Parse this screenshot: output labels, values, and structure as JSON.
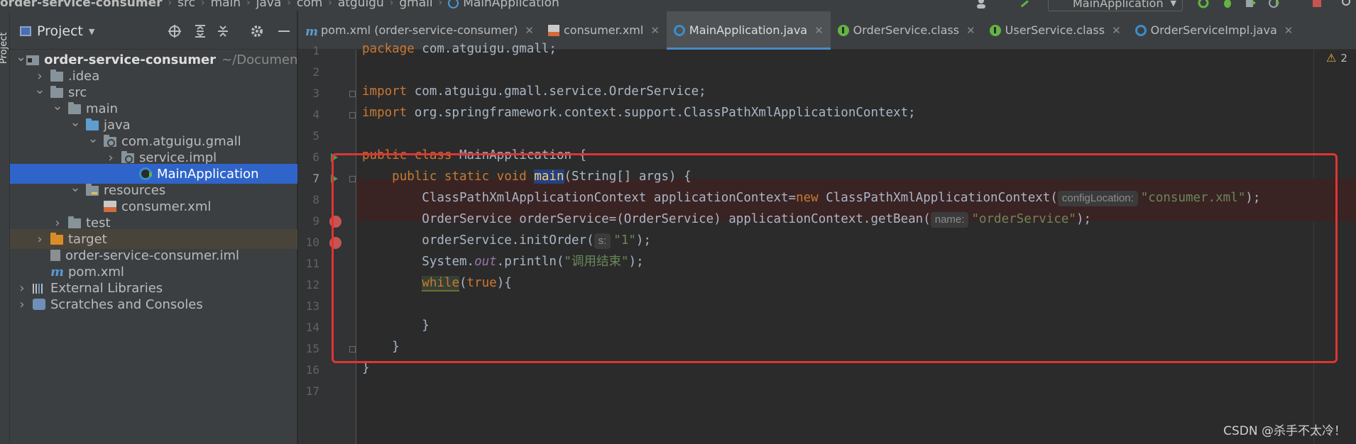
{
  "breadcrumb": {
    "items": [
      "order-service-consumer",
      "src",
      "main",
      "java",
      "com",
      "atguigu",
      "gmall",
      "MainApplication"
    ]
  },
  "toolbar": {
    "run_config": "MainApplication"
  },
  "side_strip": {
    "label": "Project"
  },
  "project_panel": {
    "title": "Project",
    "tree": [
      {
        "label": "order-service-consumer",
        "hint": "~/Documen",
        "depth": 0,
        "arrow": "open",
        "icon": "module"
      },
      {
        "label": ".idea",
        "depth": 1,
        "arrow": "closed",
        "icon": "folder"
      },
      {
        "label": "src",
        "depth": 1,
        "arrow": "open",
        "icon": "folder"
      },
      {
        "label": "main",
        "depth": 2,
        "arrow": "open",
        "icon": "folder"
      },
      {
        "label": "java",
        "depth": 3,
        "arrow": "open",
        "icon": "folder-blue"
      },
      {
        "label": "com.atguigu.gmall",
        "depth": 4,
        "arrow": "open",
        "icon": "package"
      },
      {
        "label": "service.impl",
        "depth": 5,
        "arrow": "closed",
        "icon": "package"
      },
      {
        "label": "MainApplication",
        "depth": 6,
        "arrow": "none",
        "icon": "java-class",
        "selected": true
      },
      {
        "label": "resources",
        "depth": 3,
        "arrow": "open",
        "icon": "resources-folder"
      },
      {
        "label": "consumer.xml",
        "depth": 4,
        "arrow": "none",
        "icon": "xml-file"
      },
      {
        "label": "test",
        "depth": 2,
        "arrow": "closed",
        "icon": "folder"
      },
      {
        "label": "target",
        "depth": 1,
        "arrow": "closed",
        "icon": "folder-orange",
        "excluded": true
      },
      {
        "label": "order-service-consumer.iml",
        "depth": 1,
        "arrow": "none",
        "icon": "iml-file"
      },
      {
        "label": "pom.xml",
        "depth": 1,
        "arrow": "none",
        "icon": "maven-file"
      },
      {
        "label": "External Libraries",
        "depth": 0,
        "arrow": "closed",
        "icon": "libraries"
      },
      {
        "label": "Scratches and Consoles",
        "depth": 0,
        "arrow": "closed",
        "icon": "scratches"
      }
    ]
  },
  "tabs": [
    {
      "label": "pom.xml (order-service-consumer)",
      "icon": "maven"
    },
    {
      "label": "consumer.xml",
      "icon": "xml"
    },
    {
      "label": "MainApplication.java",
      "icon": "class",
      "active": true
    },
    {
      "label": "OrderService.class",
      "icon": "interface"
    },
    {
      "label": "UserService.class",
      "icon": "interface"
    },
    {
      "label": "OrderServiceImpl.java",
      "icon": "class"
    }
  ],
  "editor": {
    "warning_count": "2",
    "line_numbers": [
      "1",
      "2",
      "3",
      "4",
      "5",
      "6",
      "7",
      "8",
      "9",
      "10",
      "11",
      "12",
      "13",
      "14",
      "15",
      "16",
      "17"
    ],
    "code": {
      "l1_kw": "package",
      "l1_rest": " com.atguigu.gmall;",
      "l3_kw": "import",
      "l3_rest": " com.atguigu.gmall.service.OrderService;",
      "l4_kw": "import",
      "l4_rest": " org.springframework.context.support.ClassPathXmlApplicationContext;",
      "l6_kw": "public class",
      "l6_rest": " MainApplication {",
      "l7_kw": "public static void",
      "l7_method": "main",
      "l7_rest": "(String[] args) {",
      "l8_a": "ClassPathXmlApplicationContext applicationContext=",
      "l8_kw": "new",
      "l8_b": " ClassPathXmlApplicationContext(",
      "l8_hint": "configLocation:",
      "l8_str": "\"consumer.xml\"",
      "l8_end": ");",
      "l9_a": "OrderService orderService=(OrderService) applicationContext.getBean(",
      "l9_hint": "name:",
      "l9_str": "\"orderService\"",
      "l9_end": ");",
      "l10_a": "orderService.initOrder(",
      "l10_hint": "s:",
      "l10_str": "\"1\"",
      "l10_end": ");",
      "l11_a": "System.",
      "l11_field": "out",
      "l11_b": ".println(",
      "l11_str": "\"调用结束\"",
      "l11_end": ");",
      "l12_kw": "while",
      "l12_b": "(",
      "l12_kw2": "true",
      "l12_end": "){",
      "l14": "}",
      "l15": "}",
      "l16": "}"
    }
  },
  "watermark": "CSDN @杀手不太冷！"
}
